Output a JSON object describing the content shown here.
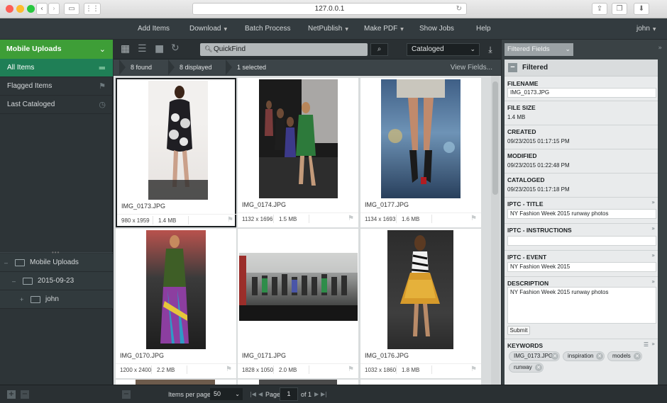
{
  "browser": {
    "url": "127.0.0.1",
    "icons": {
      "back": "chevron-left-icon",
      "forward": "chevron-right-icon",
      "sidebar": "sidebar-icon",
      "apps": "grid-icon",
      "reload": "reload-icon",
      "share": "share-icon",
      "tabs": "tabs-icon",
      "downloads": "download-icon"
    }
  },
  "nav": {
    "items": [
      "Add Items",
      "Download",
      "Batch Process",
      "NetPublish",
      "Make PDF",
      "Show Jobs",
      "Help"
    ],
    "user": "john"
  },
  "sidebar": {
    "header": "Mobile Uploads",
    "items": [
      {
        "label": "All Items",
        "icon": "folder-icon",
        "active": true
      },
      {
        "label": "Flagged Items",
        "icon": "flag-icon",
        "active": false
      },
      {
        "label": "Last Cataloged",
        "icon": "history-icon",
        "active": false
      }
    ],
    "tree": [
      {
        "label": "Mobile Uploads",
        "toggle": "–"
      },
      {
        "label": "2015-09-23",
        "toggle": "–"
      },
      {
        "label": "john",
        "toggle": "+"
      }
    ]
  },
  "toolbar": {
    "search_value": "QuickFind",
    "view_select": "Cataloged"
  },
  "stats": {
    "found": "8 found",
    "displayed": "8 displayed",
    "selected": "1 selected",
    "view_fields": "View Fields..."
  },
  "items": [
    {
      "name": "IMG_0173.JPG",
      "dims": "980 x 1959",
      "size": "1.4 MB",
      "selected": true
    },
    {
      "name": "IMG_0174.JPG",
      "dims": "1132 x 1696",
      "size": "1.5 MB",
      "selected": false
    },
    {
      "name": "IMG_0177.JPG",
      "dims": "1134 x 1693",
      "size": "1.6 MB",
      "selected": false
    },
    {
      "name": "IMG_0170.JPG",
      "dims": "1200 x 2400",
      "size": "2.2 MB",
      "selected": false
    },
    {
      "name": "IMG_0171.JPG",
      "dims": "1828 x 1050",
      "size": "2.0 MB",
      "selected": false
    },
    {
      "name": "IMG_0176.JPG",
      "dims": "1032 x 1860",
      "size": "1.8 MB",
      "selected": false
    }
  ],
  "pagination": {
    "items_per_page_label": "Items per page:",
    "items_per_page": "50",
    "page_label": "Page",
    "page": "1",
    "of_label": "of 1"
  },
  "panel": {
    "view_select": "Filtered Fields",
    "header": "Filtered",
    "filename_label": "FILENAME",
    "filename": "IMG_0173.JPG",
    "filesize_label": "FILE SIZE",
    "filesize": "1.4 MB",
    "created_label": "CREATED",
    "created": "09/23/2015 01:17:15 PM",
    "modified_label": "MODIFIED",
    "modified": "09/23/2015 01:22:48 PM",
    "cataloged_label": "CATALOGED",
    "cataloged": "09/23/2015 01:17:18 PM",
    "iptc_title_label": "IPTC - TITLE",
    "iptc_title": "NY Fashion Week 2015 runway photos",
    "iptc_instructions_label": "IPTC - INSTRUCTIONS",
    "iptc_instructions": "",
    "iptc_event_label": "IPTC - EVENT",
    "iptc_event": "NY Fashion Week 2015",
    "description_label": "DESCRIPTION",
    "description": "NY Fashion Week 2015 runway photos",
    "submit": "Submit",
    "keywords_label": "KEYWORDS",
    "keywords": [
      "IMG_0173.JPG",
      "inspiration",
      "models",
      "runway"
    ]
  },
  "colors": {
    "accent_green": "#3e9e37",
    "active_item": "#1f7f56",
    "dark_bg": "#2a3033"
  }
}
